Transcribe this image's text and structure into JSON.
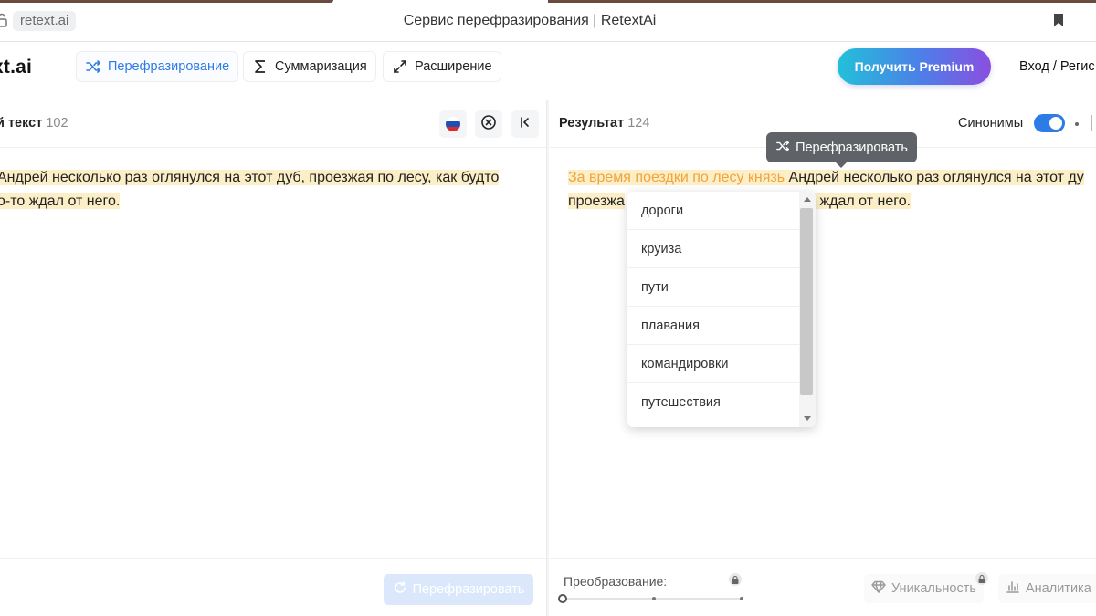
{
  "browser": {
    "url": "retext.ai",
    "title": "Сервис перефразирования | RetextAi"
  },
  "header": {
    "logo": "xt.ai",
    "modes": [
      {
        "label": "Перефразирование",
        "icon": "shuffle-icon",
        "active": true
      },
      {
        "label": "Суммаризация",
        "icon": "sigma-icon",
        "active": false
      },
      {
        "label": "Расширение",
        "icon": "expand-icon",
        "active": false
      }
    ],
    "premium_label": "Получить Premium",
    "login_label": "Вход / Регис"
  },
  "left_panel": {
    "title": "й текст",
    "count": "102",
    "lines": [
      "Андрей несколько раз оглянулся на этот дуб, проезжая по лесу, как будто",
      "о-то ждал от него."
    ],
    "paraphrase_button": "Перефразировать"
  },
  "right_panel": {
    "title": "Результат",
    "count": "124",
    "synonyms_label": "Синонимы",
    "synonyms_on": true,
    "line1_highlight": "За время поездки по лесу князь",
    "line1_rest": " Андрей несколько раз оглянулся на этот ду",
    "line2_start": "проезжа",
    "line2_end": "то ждал от него.",
    "tooltip": "Перефразировать",
    "synonyms": [
      "дороги",
      "круиза",
      "пути",
      "плавания",
      "командировки",
      "путешествия"
    ],
    "transform_label": "Преобразование:",
    "uniqueness_label": "Уникальность",
    "analytics_label": "Аналитика"
  },
  "colors": {
    "accent": "#2d7be5",
    "highlight": "#fcefc7",
    "changed_text": "#f1a33b"
  }
}
